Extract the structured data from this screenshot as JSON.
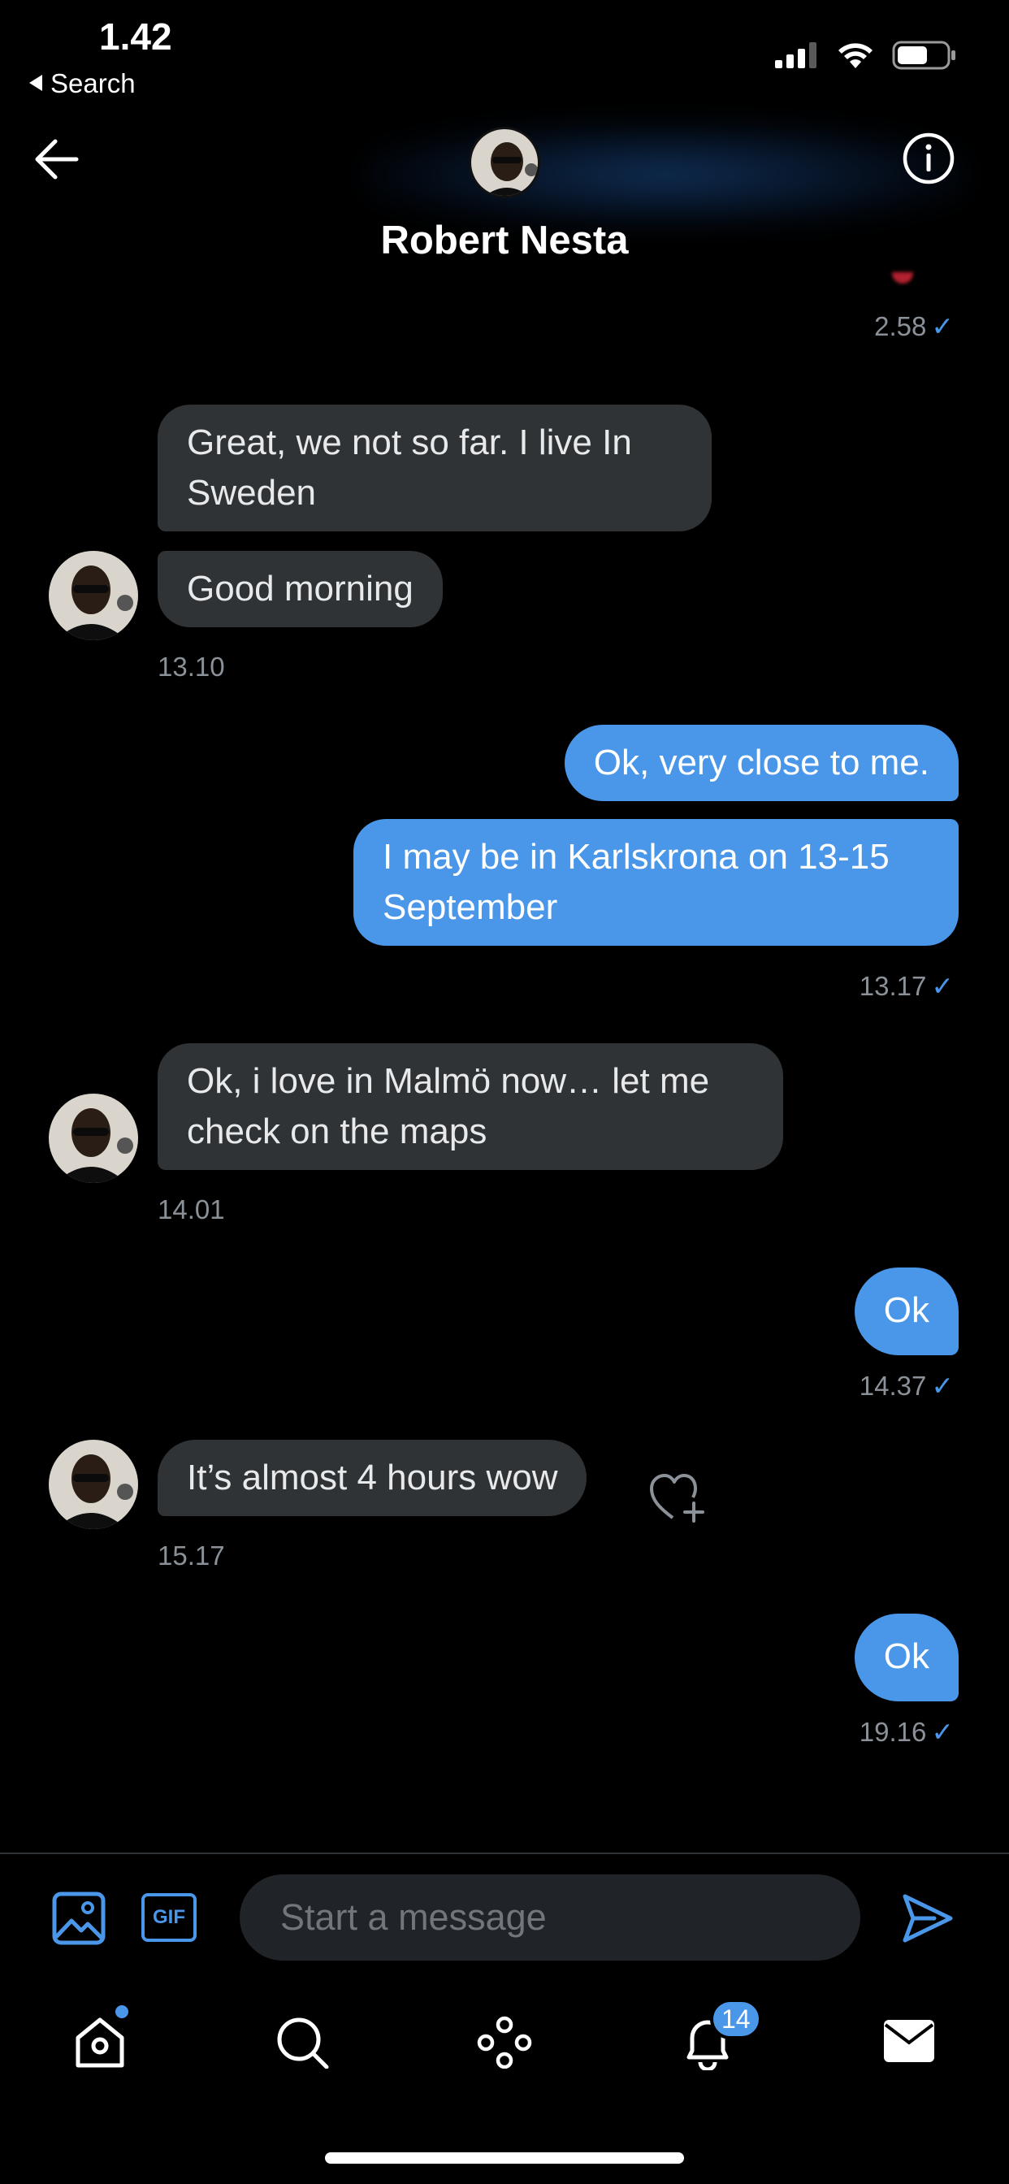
{
  "status_bar": {
    "time": "1.42",
    "back_label": "Search"
  },
  "header": {
    "contact_name": "Robert Nesta"
  },
  "messages": [
    {
      "side": "sent",
      "timestamp": "2.58"
    },
    {
      "side": "received",
      "text": "Great, we not so far. I live In Sweden"
    },
    {
      "side": "received",
      "text": "Good morning",
      "timestamp": "13.10"
    },
    {
      "side": "sent",
      "text": "Ok, very close to me."
    },
    {
      "side": "sent",
      "text": "I may be in Karlskrona on 13-15 September",
      "timestamp": "13.17"
    },
    {
      "side": "received",
      "text": "Ok, i love in Malmö now… let me check on the maps",
      "timestamp": "14.01"
    },
    {
      "side": "sent",
      "text": "Ok",
      "timestamp": "14.37"
    },
    {
      "side": "received",
      "text": "It’s almost 4 hours wow",
      "timestamp": "15.17"
    },
    {
      "side": "sent",
      "text": "Ok",
      "timestamp": "19.16"
    }
  ],
  "read_mark": "✓",
  "composer": {
    "placeholder": "Start a message",
    "gif_label": "GIF"
  },
  "tab_bar": {
    "notifications_badge": "14"
  },
  "icons": {
    "back": "arrow-left-icon",
    "info": "info-icon",
    "react": "heart-plus-icon",
    "media": "image-icon",
    "send": "send-icon",
    "tabs": [
      "home-icon",
      "search-icon",
      "spaces-icon",
      "bell-icon",
      "mail-icon"
    ]
  },
  "colors": {
    "accent": "#4a96e8",
    "received_bubble": "#2f3336",
    "background": "#000000"
  }
}
